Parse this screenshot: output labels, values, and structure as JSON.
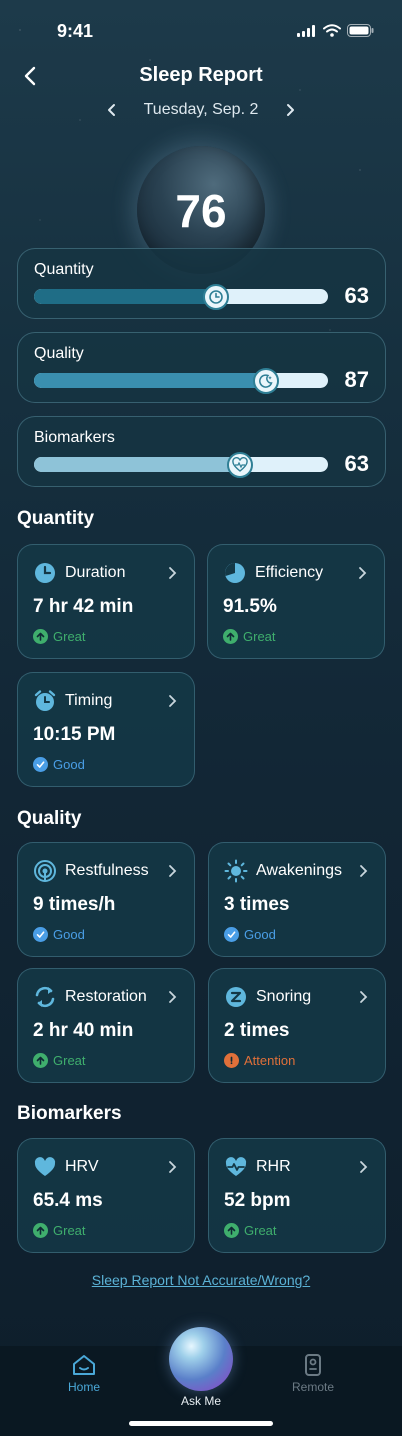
{
  "status_bar": {
    "time": "9:41"
  },
  "header": {
    "title": "Sleep Report",
    "date": "Tuesday, Sep. 2"
  },
  "overall_score": "76",
  "score_bars": [
    {
      "label": "Quantity",
      "value": "63",
      "fill_fraction": 0.62,
      "color": "#1f6d86"
    },
    {
      "label": "Quality",
      "value": "87",
      "fill_fraction": 0.79,
      "color": "#3a8faf"
    },
    {
      "label": "Biomarkers",
      "value": "63",
      "fill_fraction": 0.7,
      "color": "#8ec3d8"
    }
  ],
  "sections": {
    "quantity": "Quantity",
    "quality": "Quality",
    "biomarkers": "Biomarkers"
  },
  "metrics": {
    "duration": {
      "name": "Duration",
      "value": "7 hr 42 min",
      "status": "Great"
    },
    "efficiency": {
      "name": "Efficiency",
      "value": "91.5%",
      "status": "Great"
    },
    "timing": {
      "name": "Timing",
      "value": "10:15 PM",
      "status": "Good"
    },
    "restfulness": {
      "name": "Restfulness",
      "value": "9 times/h",
      "status": "Good"
    },
    "awakenings": {
      "name": "Awakenings",
      "value": "3 times",
      "status": "Good"
    },
    "restoration": {
      "name": "Restoration",
      "value": "2 hr 40 min",
      "status": "Great"
    },
    "snoring": {
      "name": "Snoring",
      "value": "2 times",
      "status": "Attention"
    },
    "hrv": {
      "name": "HRV",
      "value": "65.4 ms",
      "status": "Great"
    },
    "rhr": {
      "name": "RHR",
      "value": "52 bpm",
      "status": "Great"
    }
  },
  "colors": {
    "great": "#3fae6d",
    "good": "#4a9ee6",
    "attention": "#e0703a",
    "icon": "#5fb7dd"
  },
  "feedback_link": "Sleep Report Not Accurate/Wrong?",
  "tab_bar": {
    "home": "Home",
    "ask": "Ask Me",
    "remote": "Remote"
  }
}
